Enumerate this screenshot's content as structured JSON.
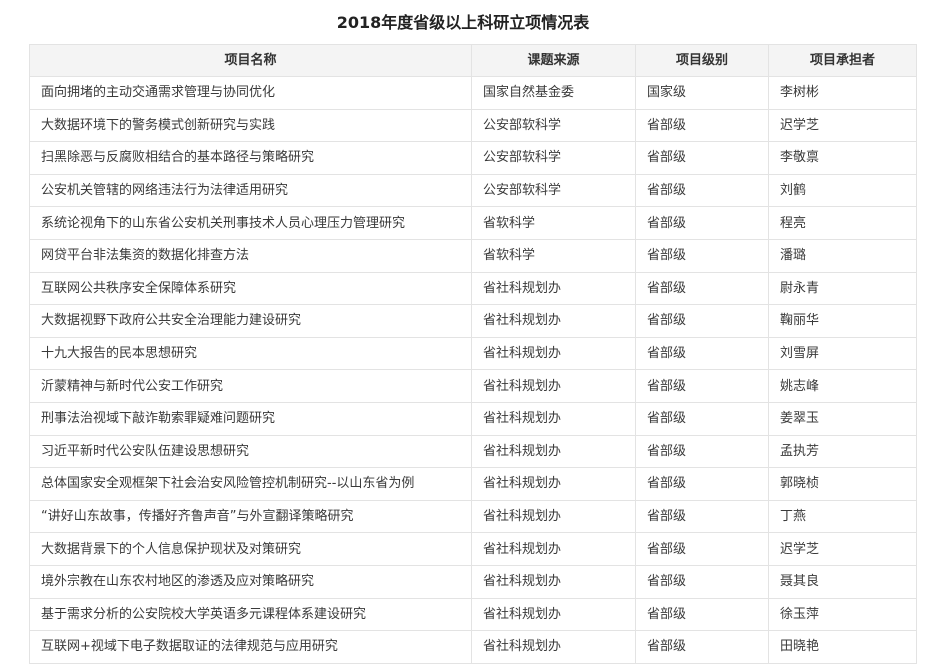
{
  "title": "2018年度省级以上科研立项情况表",
  "table": {
    "headers": [
      "项目名称",
      "课题来源",
      "项目级别",
      "项目承担者"
    ],
    "rows": [
      [
        "面向拥堵的主动交通需求管理与协同优化",
        "国家自然基金委",
        "国家级",
        "李树彬"
      ],
      [
        "大数据环境下的警务模式创新研究与实践",
        "公安部软科学",
        "省部级",
        "迟学芝"
      ],
      [
        "扫黑除恶与反腐败相结合的基本路径与策略研究",
        "公安部软科学",
        "省部级",
        "李敬禀"
      ],
      [
        "公安机关管辖的网络违法行为法律适用研究",
        "公安部软科学",
        "省部级",
        "刘鹤"
      ],
      [
        "系统论视角下的山东省公安机关刑事技术人员心理压力管理研究",
        "省软科学",
        "省部级",
        "程亮"
      ],
      [
        "网贷平台非法集资的数据化排查方法",
        "省软科学",
        "省部级",
        "潘璐"
      ],
      [
        "互联网公共秩序安全保障体系研究",
        "省社科规划办",
        "省部级",
        "尉永青"
      ],
      [
        "大数据视野下政府公共安全治理能力建设研究",
        "省社科规划办",
        "省部级",
        "鞠丽华"
      ],
      [
        "十九大报告的民本思想研究",
        "省社科规划办",
        "省部级",
        "刘雪屏"
      ],
      [
        "沂蒙精神与新时代公安工作研究",
        "省社科规划办",
        "省部级",
        "姚志峰"
      ],
      [
        "刑事法治视域下敲诈勒索罪疑难问题研究",
        "省社科规划办",
        "省部级",
        "姜翠玉"
      ],
      [
        "习近平新时代公安队伍建设思想研究",
        "省社科规划办",
        "省部级",
        "孟执芳"
      ],
      [
        "总体国家安全观框架下社会治安风险管控机制研究--以山东省为例",
        "省社科规划办",
        "省部级",
        "郭晓桢"
      ],
      [
        "“讲好山东故事，传播好齐鲁声音”与外宣翻译策略研究",
        "省社科规划办",
        "省部级",
        "丁燕"
      ],
      [
        "大数据背景下的个人信息保护现状及对策研究",
        "省社科规划办",
        "省部级",
        "迟学芝"
      ],
      [
        "境外宗教在山东农村地区的渗透及应对策略研究",
        "省社科规划办",
        "省部级",
        "聂其良"
      ],
      [
        "基于需求分析的公安院校大学英语多元课程体系建设研究",
        "省社科规划办",
        "省部级",
        "徐玉萍"
      ],
      [
        "互联网+视域下电子数据取证的法律规范与应用研究",
        "省社科规划办",
        "省部级",
        "田晓艳"
      ]
    ]
  }
}
